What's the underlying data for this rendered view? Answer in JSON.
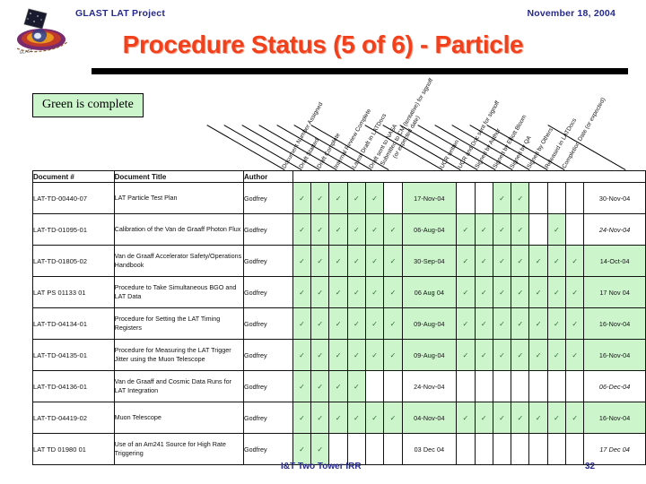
{
  "header": {
    "project": "GLAST LAT Project",
    "date": "November 18, 2004",
    "title": "Procedure Status (5 of 6) - Particle"
  },
  "legend": {
    "text": "Green is complete"
  },
  "colors": {
    "title_red": "#f1411c",
    "header_blue": "#26298c",
    "complete_green": "#ccf5cc",
    "check_green": "#2e6b2e"
  },
  "table": {
    "text_columns": [
      "Document #",
      "Document Title",
      "Author"
    ],
    "status_columns": [
      "Document Number Assigned",
      "Draft Started",
      "Draft Complete",
      "Internal Review Complete",
      "Latest Draft in LATDocs",
      "Draft sent to NASA",
      "Submitted to CM (tentative) for signoff  (or expected date)",
      "UCR written",
      "UCR and Doc sent for signoff",
      "Signed by Author",
      "Signed by Elliott Bloom",
      "Signed by QA",
      "Signed by Others",
      "Released in LATDocs",
      "Completion Date (or expected)"
    ],
    "rows": [
      {
        "doc": "LAT-TD-00440-07",
        "title": "LAT Particle Test Plan",
        "author": "Godfrey",
        "checks": [
          true,
          true,
          true,
          true,
          true,
          false
        ],
        "submitted_date": "17-Nov-04",
        "submitted_green": true,
        "checks2": [
          false,
          false,
          true,
          true,
          false,
          false,
          false
        ],
        "completion_date": "30-Nov-04",
        "completion_green": false,
        "completion_italic": false
      },
      {
        "doc": "LAT-TD-01095-01",
        "title": "Calibration of the Van de Graaff Photon Flux",
        "author": "Godfrey",
        "checks": [
          true,
          true,
          true,
          true,
          true,
          true
        ],
        "submitted_date": "06-Aug-04",
        "submitted_green": true,
        "checks2": [
          true,
          true,
          true,
          true,
          false,
          true,
          false
        ],
        "completion_date": "24-Nov-04",
        "completion_green": false,
        "completion_italic": true
      },
      {
        "doc": "LAT-TD-01805-02",
        "title": "Van de Graaff Accelerator Safety/Operations Handbook",
        "author": "Godfrey",
        "checks": [
          true,
          true,
          true,
          true,
          true,
          true
        ],
        "submitted_date": "30-Sep-04",
        "submitted_green": true,
        "checks2": [
          true,
          true,
          true,
          true,
          true,
          true,
          true
        ],
        "completion_date": "14-Oct-04",
        "completion_green": true,
        "completion_italic": false
      },
      {
        "doc": "LAT PS 01133 01",
        "title": "Procedure to Take Simultaneous BGO and LAT Data",
        "author": "Godfrey",
        "checks": [
          true,
          true,
          true,
          true,
          true,
          true
        ],
        "submitted_date": "06 Aug 04",
        "submitted_green": true,
        "checks2": [
          true,
          true,
          true,
          true,
          true,
          true,
          true
        ],
        "completion_date": "17 Nov 04",
        "completion_green": true,
        "completion_italic": false
      },
      {
        "doc": "LAT-TD-04134-01",
        "title": "Procedure for Setting the LAT Timing Registers",
        "author": "Godfrey",
        "checks": [
          true,
          true,
          true,
          true,
          true,
          true
        ],
        "submitted_date": "09-Aug-04",
        "submitted_green": true,
        "checks2": [
          true,
          true,
          true,
          true,
          true,
          true,
          true
        ],
        "completion_date": "16-Nov-04",
        "completion_green": true,
        "completion_italic": false
      },
      {
        "doc": "LAT-TD-04135-01",
        "title": "Procedure for Measuring the LAT Trigger Jitter using the Muon Telescope",
        "author": "Godfrey",
        "checks": [
          true,
          true,
          true,
          true,
          true,
          true
        ],
        "submitted_date": "09-Aug-04",
        "submitted_green": true,
        "checks2": [
          true,
          true,
          true,
          true,
          true,
          true,
          true
        ],
        "completion_date": "16-Nov-04",
        "completion_green": true,
        "completion_italic": false
      },
      {
        "doc": "LAT-TD-04136-01",
        "title": "Van de Graaff and Cosmic Data Runs for LAT Integration",
        "author": "Godfrey",
        "checks": [
          true,
          true,
          true,
          true,
          false,
          false
        ],
        "submitted_date": "24-Nov-04",
        "submitted_green": false,
        "checks2": [
          false,
          false,
          false,
          false,
          false,
          false,
          false
        ],
        "completion_date": "06-Dec-04",
        "completion_green": false,
        "completion_italic": true
      },
      {
        "doc": "LAT-TD-04419-02",
        "title": "Muon Telescope",
        "author": "Godfrey",
        "checks": [
          true,
          true,
          true,
          true,
          true,
          true
        ],
        "submitted_date": "04-Nov-04",
        "submitted_green": true,
        "checks2": [
          true,
          true,
          true,
          true,
          true,
          true,
          true
        ],
        "completion_date": "16-Nov-04",
        "completion_green": true,
        "completion_italic": false
      },
      {
        "doc": "LAT TD 01980 01",
        "title": "Use of an Am241 Source for High Rate Triggering",
        "author": "Godfrey",
        "checks": [
          true,
          true,
          false,
          false,
          false,
          false
        ],
        "submitted_date": "03 Dec 04",
        "submitted_green": false,
        "checks2": [
          false,
          false,
          false,
          false,
          false,
          false,
          false
        ],
        "completion_date": "17 Dec 04",
        "completion_green": false,
        "completion_italic": true
      }
    ],
    "check_glyph": "✓"
  },
  "footer": {
    "left": "I&T Two Tower IRR",
    "page": "32"
  }
}
